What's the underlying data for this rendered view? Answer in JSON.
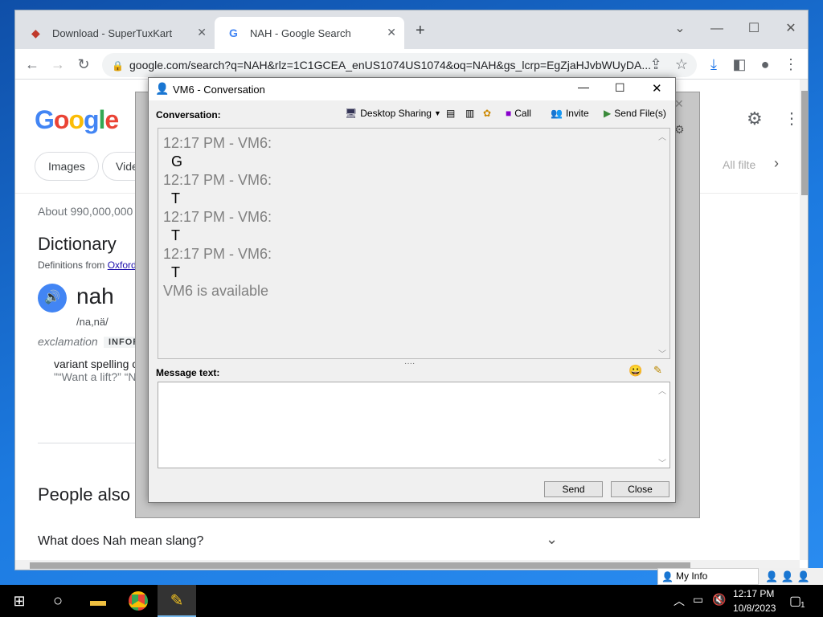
{
  "browser": {
    "tabs": [
      {
        "label": "Download - SuperTuxKart"
      },
      {
        "label": "NAH - Google Search"
      }
    ],
    "url": "google.com/search?q=NAH&rlz=1C1GCEA_enUS1074US1074&oq=NAH&gs_lcrp=EgZjaHJvbWUyDA..."
  },
  "google": {
    "logo": "Google",
    "filters": [
      "Images",
      "Vide"
    ],
    "all_filters": "All filte",
    "result_stats": "About 990,000,000",
    "dictionary_title": "Dictionary",
    "definitions_from": "Definitions from",
    "oxford": "Oxford",
    "word": "nah",
    "phonetic": "/na,nä/",
    "pos": "exclamation",
    "badge": "INFOR",
    "definition": "variant spelling o",
    "example": "\"“Want a lift?” “N",
    "people_also": "People also a",
    "question": "What does Nah mean slang?"
  },
  "dialog": {
    "title": "VM6 - Conversation",
    "conversation_label": "Conversation:",
    "desktop_sharing": "Desktop Sharing",
    "call": "Call",
    "invite": "Invite",
    "send_files": "Send File(s)",
    "messages": [
      {
        "stamp": "12:17 PM - VM6:",
        "text": "G"
      },
      {
        "stamp": "12:17 PM - VM6:",
        "text": "T"
      },
      {
        "stamp": "12:17 PM - VM6:",
        "text": "T"
      },
      {
        "stamp": "12:17 PM - VM6:",
        "text": "T"
      }
    ],
    "status_line": "VM6 is available",
    "message_text_label": "Message text:",
    "send_label": "Send",
    "close_label": "Close"
  },
  "tray": {
    "my_info": "My Info",
    "time": "12:17 PM",
    "date": "10/8/2023",
    "notification_count": "1"
  }
}
